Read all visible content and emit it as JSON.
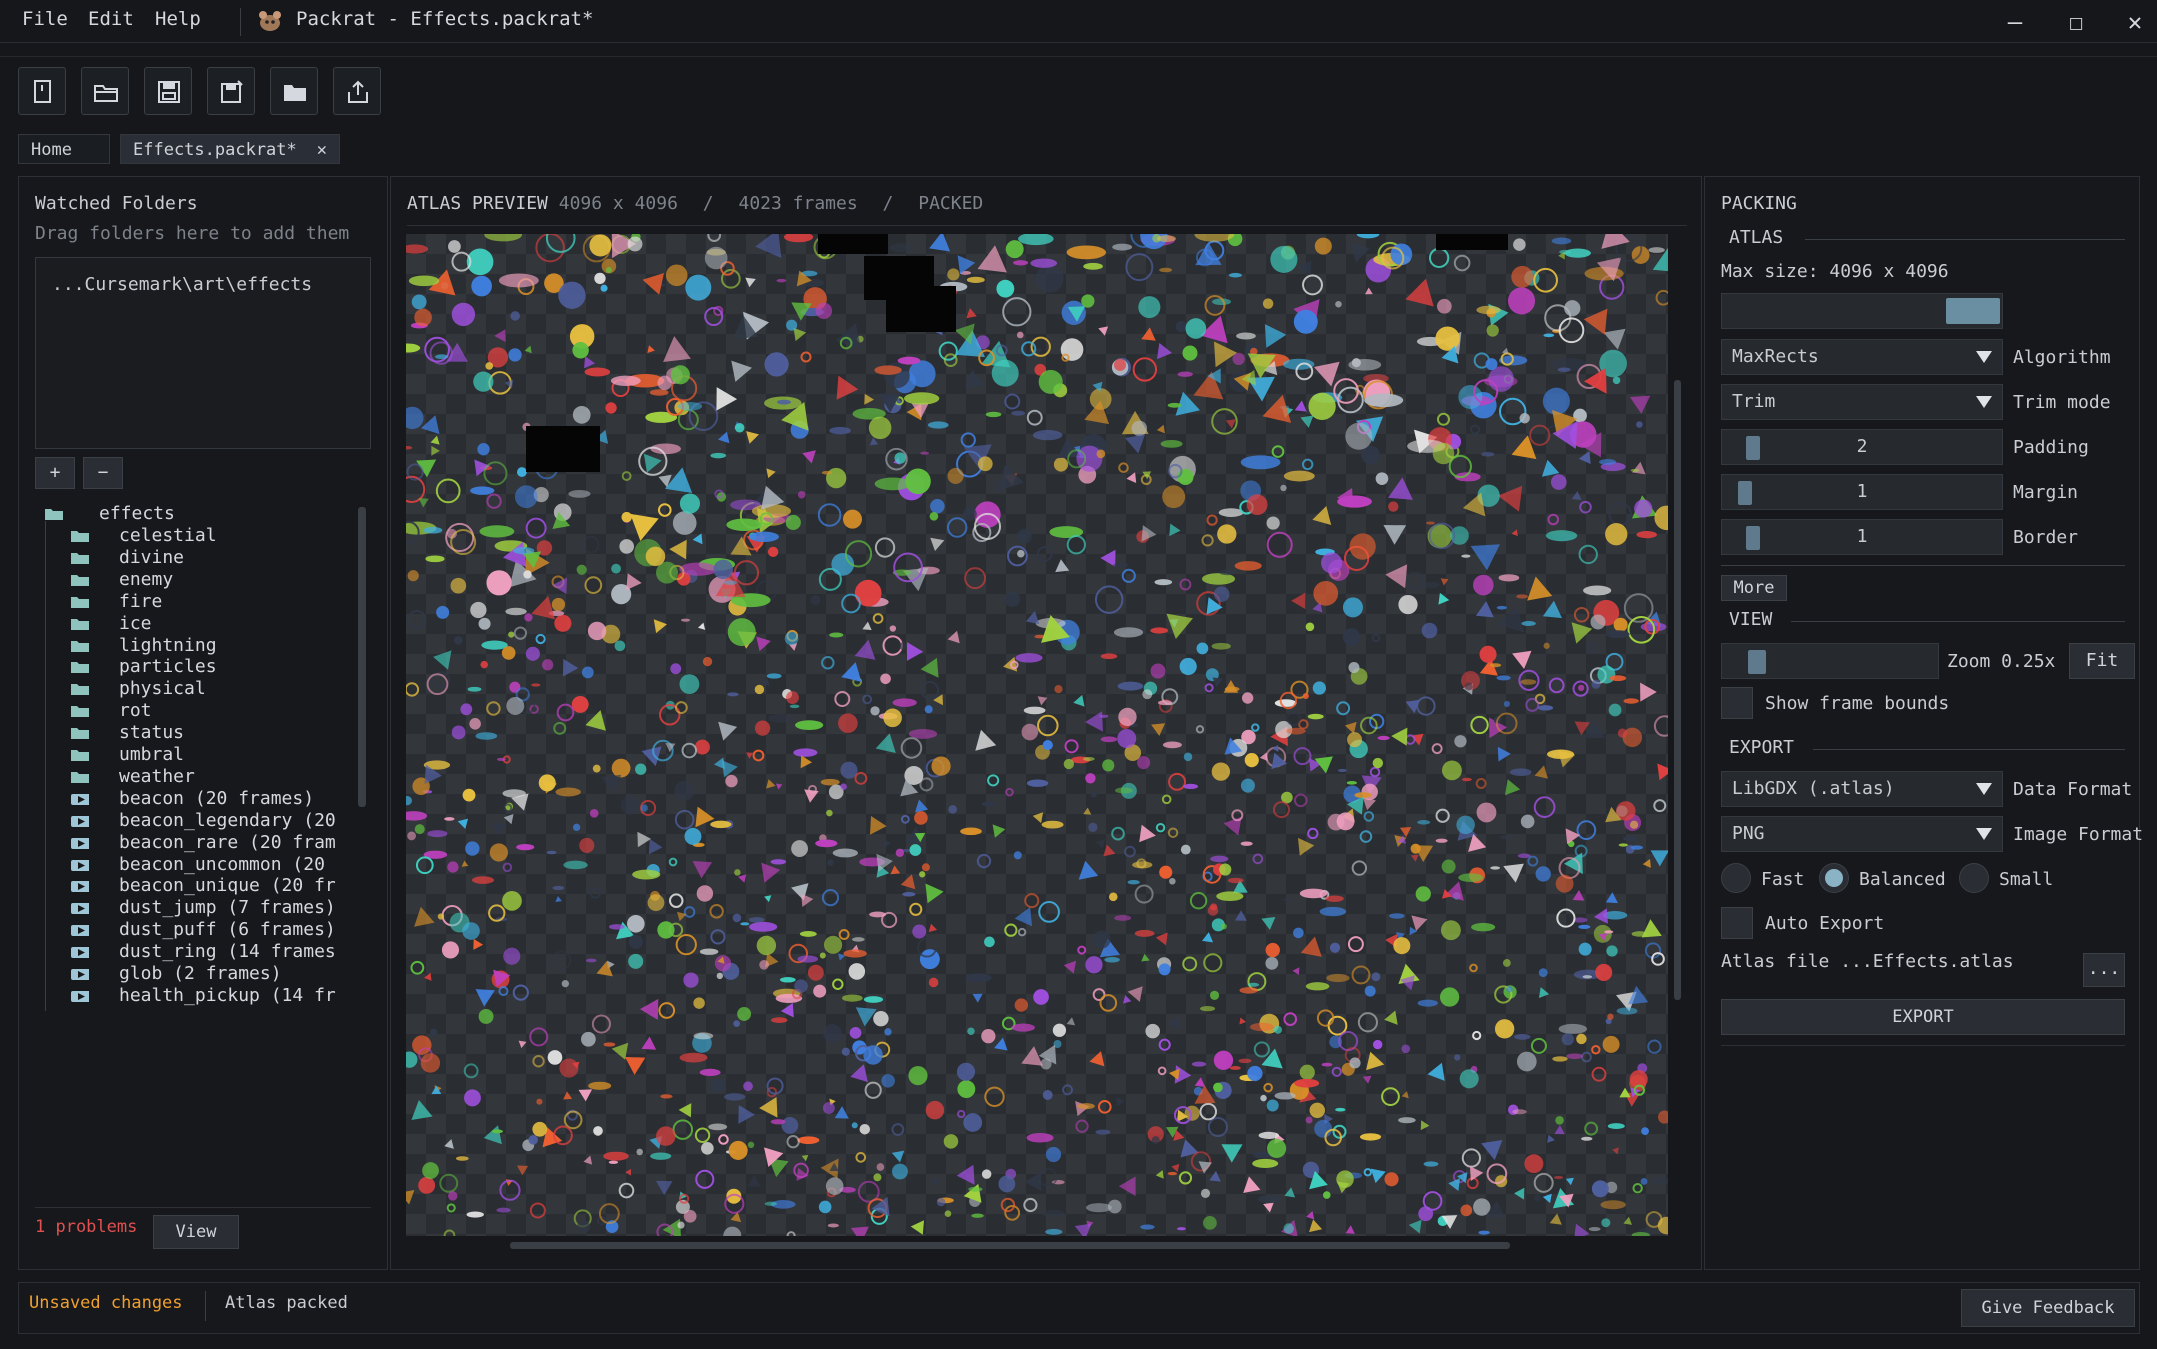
{
  "menu": [
    "File",
    "Edit",
    "Help"
  ],
  "window_title": "Packrat - Effects.packrat*",
  "window_controls": {
    "minimize": "—",
    "maximize": "☐",
    "close": "✕"
  },
  "toolbar_icons": [
    "new-file-icon",
    "open-folder-icon",
    "save-icon",
    "save-as-icon",
    "folder-icon",
    "export-icon"
  ],
  "tabs": [
    {
      "label": "Home",
      "active": false
    },
    {
      "label": "Effects.packrat*",
      "active": true,
      "close": "✕"
    }
  ],
  "left": {
    "title": "Watched Folders",
    "hint": "Drag folders here to add them",
    "folders": [
      "...Cursemark\\art\\effects"
    ],
    "add_label": "+",
    "remove_label": "−",
    "tree_root": "effects",
    "tree_folders": [
      "celestial",
      "divine",
      "enemy",
      "fire",
      "ice",
      "lightning",
      "particles",
      "physical",
      "rot",
      "status",
      "umbral",
      "weather"
    ],
    "tree_anims": [
      "beacon  (20 frames)",
      "beacon_legendary  (20",
      "beacon_rare  (20 fram",
      "beacon_uncommon  (20",
      "beacon_unique  (20 fr",
      "dust_jump  (7 frames)",
      "dust_puff  (6 frames)",
      "dust_ring  (14 frames",
      "glob  (2 frames)",
      "health_pickup  (14 fr"
    ],
    "problems": "1 problems",
    "view_label": "View"
  },
  "center": {
    "title": "ATLAS PREVIEW",
    "size": "4096 x 4096",
    "sep": "/",
    "frames": "4023 frames",
    "status": "PACKED"
  },
  "right": {
    "packing": "PACKING",
    "atlas": "ATLAS",
    "max_size": "Max size: 4096 x 4096",
    "max_size_level": 0.85,
    "algorithm": {
      "value": "MaxRects",
      "label": "Algorithm"
    },
    "trim": {
      "value": "Trim",
      "label": "Trim mode"
    },
    "padding": {
      "value": "2",
      "label": "Padding"
    },
    "margin": {
      "value": "1",
      "label": "Margin"
    },
    "border": {
      "value": "1",
      "label": "Border"
    },
    "more": "More",
    "view": "VIEW",
    "zoom": "Zoom 0.25x",
    "fit": "Fit",
    "show_bounds": "Show frame bounds",
    "export_head": "EXPORT",
    "data_format": {
      "value": "LibGDX (.atlas)",
      "label": "Data Format"
    },
    "image_format": {
      "value": "PNG",
      "label": "Image Format"
    },
    "quality": [
      {
        "label": "Fast",
        "on": false
      },
      {
        "label": "Balanced",
        "on": true
      },
      {
        "label": "Small",
        "on": false
      }
    ],
    "auto_export": "Auto Export",
    "atlas_file": "Atlas file ...Effects.atlas",
    "browse": "...",
    "export_button": "EXPORT"
  },
  "status": {
    "unsaved": "Unsaved changes",
    "packed": "Atlas packed",
    "feedback": "Give Feedback"
  },
  "colors": {
    "accent": "#f0a030",
    "error": "#e05050",
    "dim": "#7d828b",
    "slider": "#5f7a8d"
  }
}
